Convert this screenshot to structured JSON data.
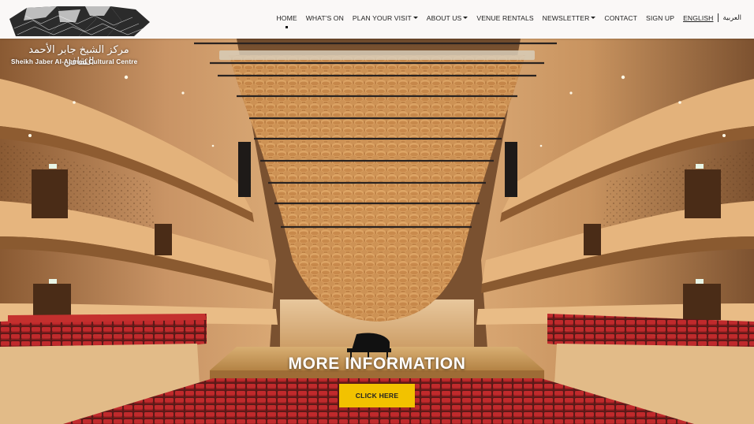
{
  "header": {
    "logo_arabic": "مركز الشيخ جابر الأحمد الثقافي",
    "logo_english": "Sheikh Jaber Al-Ahmed Cultural Centre",
    "nav": {
      "home": "HOME",
      "whats_on": "WHAT'S ON",
      "plan_your_visit": "PLAN YOUR VISIT",
      "about_us": "ABOUT US",
      "venue_rentals": "VENUE RENTALS",
      "newsletter": "NEWSLETTER",
      "contact": "CONTACT",
      "sign_up": "SIGN UP",
      "english": "ENGLISH",
      "arabic": "العربية"
    },
    "active_item": "home"
  },
  "hero": {
    "cta_title": "MORE INFORMATION",
    "cta_button": "CLICK HERE"
  },
  "colors": {
    "accent": "#f2c200",
    "header_bg": "#ffffff",
    "hall_wood": "#c9925c",
    "seat_red": "#b4202a"
  },
  "icons": [
    "logo-mark",
    "caret-down-icon",
    "piano-icon"
  ]
}
